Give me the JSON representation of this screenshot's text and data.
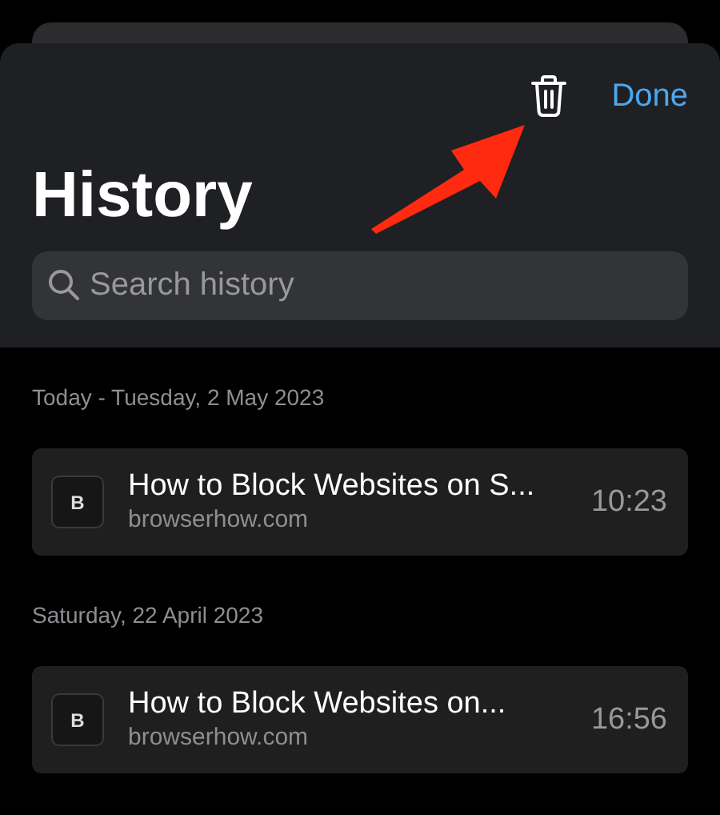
{
  "toolbar": {
    "done_label": "Done"
  },
  "title": "History",
  "search": {
    "placeholder": "Search history"
  },
  "sections": [
    {
      "date": "Today - Tuesday, 2 May 2023",
      "items": [
        {
          "favicon": "B",
          "title": "How to Block Websites on S...",
          "domain": "browserhow.com",
          "time": "10:23"
        }
      ]
    },
    {
      "date": "Saturday, 22 April 2023",
      "items": [
        {
          "favicon": "B",
          "title": "How to Block Websites on...",
          "domain": "browserhow.com",
          "time": "16:56"
        }
      ]
    }
  ]
}
